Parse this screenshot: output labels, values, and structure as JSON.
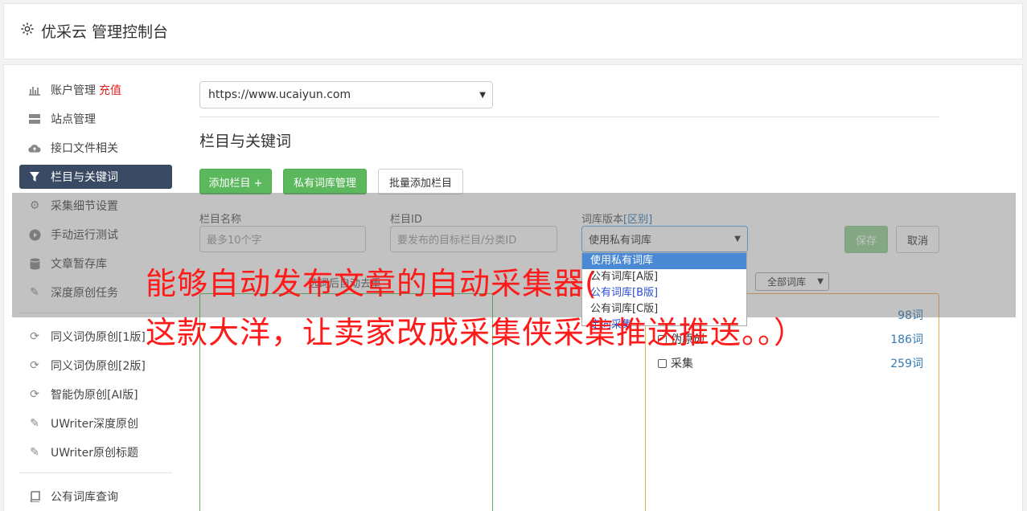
{
  "header": {
    "title": "优采云 管理控制台",
    "icon": "gear-icon"
  },
  "sidebar": {
    "items": [
      {
        "label": "账户管理",
        "icon": "bar-chart-icon",
        "badge": "充值"
      },
      {
        "label": "站点管理",
        "icon": "server-icon"
      },
      {
        "label": "接口文件相关",
        "icon": "cloud-upload-icon"
      },
      {
        "label": "栏目与关键词",
        "icon": "filter-icon",
        "active": true
      },
      {
        "label": "采集细节设置",
        "icon": "cogs-icon"
      },
      {
        "label": "手动运行测试",
        "icon": "play-circle-icon"
      },
      {
        "label": "文章暂存库",
        "icon": "database-icon"
      },
      {
        "label": "深度原创任务",
        "icon": "edit-icon"
      }
    ],
    "items2": [
      {
        "label": "同义词伪原创[1版]",
        "icon": "refresh-icon"
      },
      {
        "label": "同义词伪原创[2版]",
        "icon": "refresh-icon"
      },
      {
        "label": "智能伪原创[AI版]",
        "icon": "refresh-icon"
      },
      {
        "label": "UWriter深度原创",
        "icon": "edit-icon"
      },
      {
        "label": "UWriter原创标题",
        "icon": "edit-icon"
      }
    ],
    "items3": [
      {
        "label": "公有词库查询",
        "icon": "book-icon"
      }
    ]
  },
  "main": {
    "site_select": "https://www.ucaiyun.com",
    "section_title": "栏目与关键词",
    "buttons": {
      "add_column": "添加栏目 +",
      "private_lib": "私有词库管理",
      "batch_add": "批量添加栏目"
    },
    "form": {
      "name_label": "栏目名称",
      "name_placeholder": "最多10个字",
      "id_label": "栏目ID",
      "id_placeholder": "要发布的目标栏目/分类ID",
      "lib_label": "词库版本",
      "lib_link": "[区别]",
      "lib_value": "使用私有词库",
      "save": "保存",
      "cancel": "取消"
    },
    "dropdown": {
      "options": [
        "使用私有词库",
        "公有词库[A版]",
        "公有词库[B版]",
        "公有词库[C版]",
        "定向采集"
      ]
    },
    "hint_text": "选词后自动去重",
    "lib_filter": "全部词库",
    "libraries": [
      {
        "name": "",
        "count": "98词"
      },
      {
        "name": "伪原创",
        "count": "186词"
      },
      {
        "name": "采集",
        "count": "259词"
      }
    ]
  },
  "caption": {
    "line1": "能够自动发布文章的自动采集器(",
    "line2": "这款大洋，让卖家改成采集侠采集推送推送。。）"
  },
  "colors": {
    "active": "#3b4a64",
    "green": "#5cb85c",
    "orange": "#f0ad4e",
    "caption": "#ff1a1a"
  }
}
